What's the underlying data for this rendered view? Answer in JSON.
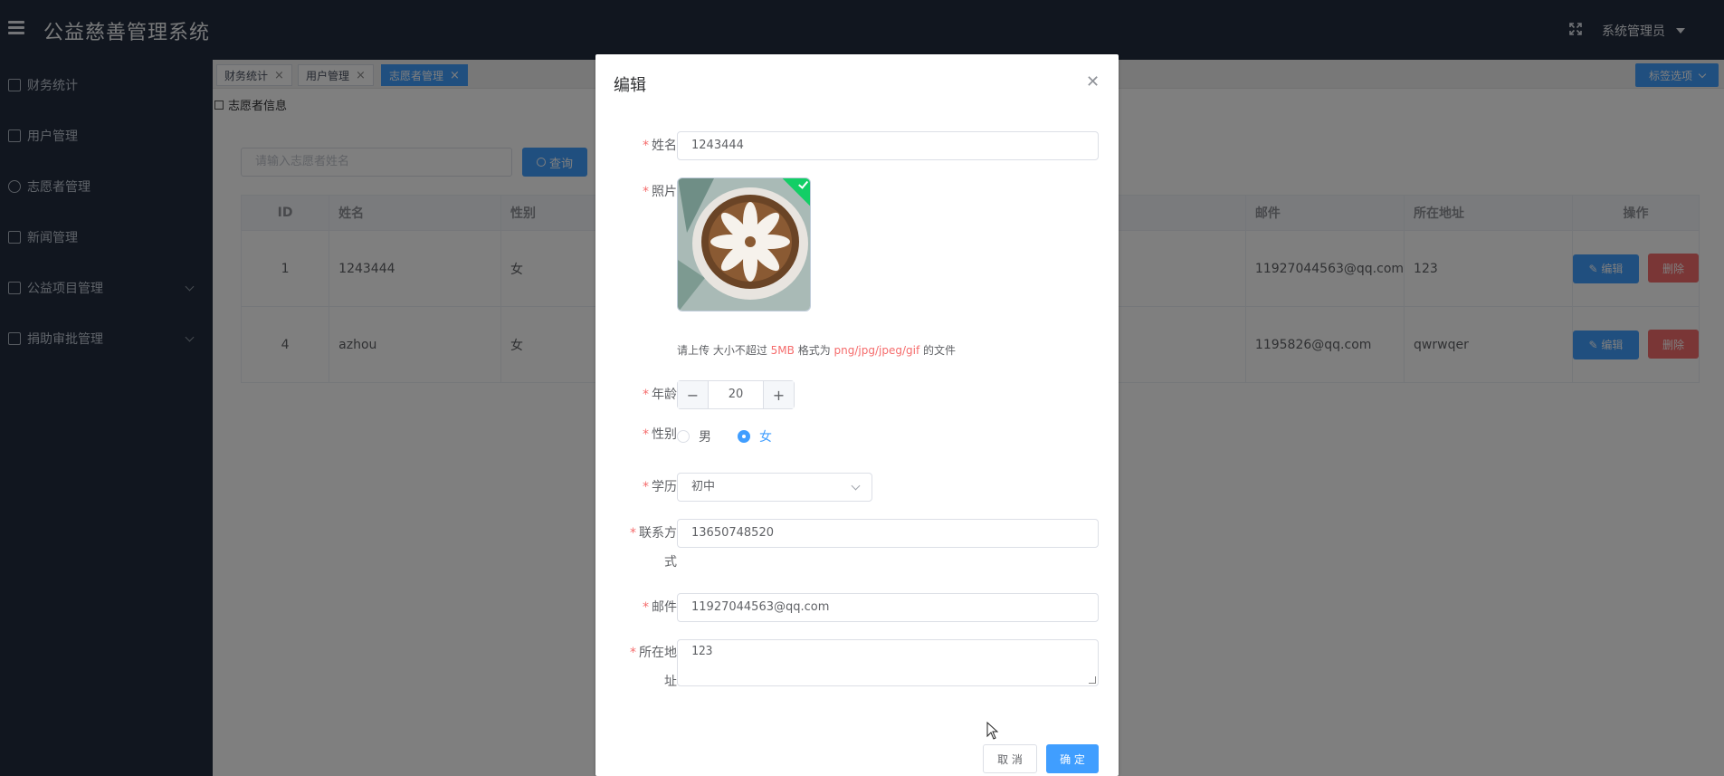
{
  "app": {
    "title": "公益慈善管理系统",
    "user": "系统管理员"
  },
  "sidebar": {
    "items": [
      {
        "label": "财务统计",
        "icon": "home-icon"
      },
      {
        "label": "用户管理",
        "icon": "document-icon"
      },
      {
        "label": "志愿者管理",
        "icon": "user-icon"
      },
      {
        "label": "新闻管理",
        "icon": "briefcase-icon"
      },
      {
        "label": "公益项目管理",
        "icon": "list-icon"
      },
      {
        "label": "捐助审批管理",
        "icon": "document-icon"
      }
    ]
  },
  "tags": [
    {
      "label": "财务统计",
      "active": false
    },
    {
      "label": "用户管理",
      "active": false
    },
    {
      "label": "志愿者管理",
      "active": true
    }
  ],
  "tag_options": "标签选项",
  "breadcrumb": "志愿者信息",
  "search": {
    "placeholder": "请输入志愿者姓名",
    "button": "查询"
  },
  "table": {
    "headers": {
      "id": "ID",
      "name": "姓名",
      "gender": "性别",
      "email": "邮件",
      "address": "所在地址",
      "ops": "操作"
    },
    "rows": [
      {
        "id": "1",
        "name": "1243444",
        "gender": "女",
        "email": "11927044563@qq.com",
        "address": "123"
      },
      {
        "id": "4",
        "name": "azhou",
        "gender": "女",
        "email": "1195826@qq.com",
        "address": "qwrwqer"
      }
    ],
    "edit_label": "编辑",
    "delete_label": "删除"
  },
  "dialog": {
    "title": "编辑",
    "name_label": "姓名",
    "name_value": "1243444",
    "photo_label": "照片",
    "hint_prefix": "请上传 大小不超过 ",
    "hint_size": "5MB",
    "hint_mid": " 格式为 ",
    "hint_formats": "png/jpg/jpeg/gif",
    "hint_suffix": " 的文件",
    "age_label": "年龄",
    "age_value": "20",
    "gender_label": "性别",
    "gender_male": "男",
    "gender_female": "女",
    "education_label": "学历",
    "education_value": "初中",
    "contact_label_1": "联系方",
    "contact_label_2": "式",
    "contact_value": "13650748520",
    "email_label": "邮件",
    "email_value": "11927044563@qq.com",
    "address_label_1": "所在地",
    "address_label_2": "址",
    "address_value": "123",
    "cancel": "取 消",
    "confirm": "确 定"
  },
  "colors": {
    "primary": "#409eff",
    "danger": "#f56c6c",
    "sidebar": "#222d3e",
    "success": "#13ce66"
  }
}
